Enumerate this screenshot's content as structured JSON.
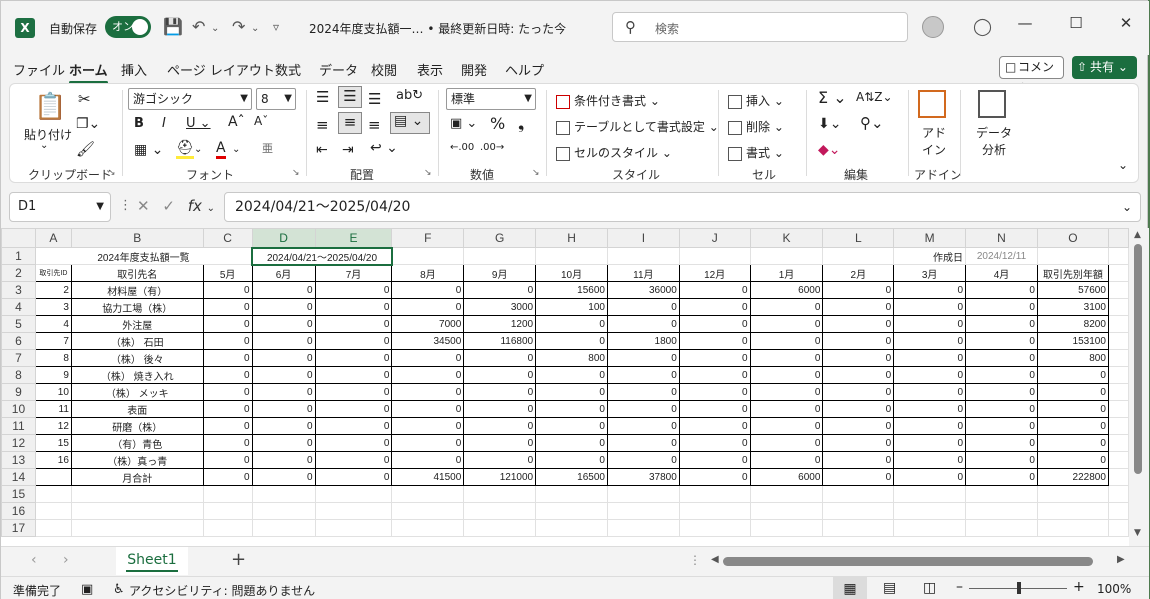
{
  "title_bar": {
    "app_icon": "X",
    "autosave_label": "自動保存",
    "autosave_state": "オン",
    "doc_title": "2024年度支払額一… • 最終更新日時: たった今",
    "search_placeholder": "検索",
    "icons": [
      "save-icon",
      "undo-icon",
      "redo-icon",
      "customize-icon",
      "search-icon",
      "avatar",
      "lightbulb-icon",
      "minimize-icon",
      "maximize-icon",
      "close-icon"
    ]
  },
  "menu": {
    "items": [
      "ファイル",
      "ホーム",
      "挿入",
      "ページ レイアウト",
      "数式",
      "データ",
      "校閲",
      "表示",
      "開発",
      "ヘルプ"
    ],
    "active": "ホーム",
    "comment_label": "コメント",
    "share_label": "共有"
  },
  "ribbon": {
    "clipboard": {
      "paste": "貼り付け",
      "label": "クリップボード"
    },
    "font": {
      "name": "游ゴシック",
      "size": "8",
      "label": "フォント"
    },
    "alignment": {
      "label": "配置"
    },
    "number": {
      "format": "標準",
      "label": "数値"
    },
    "styles": {
      "conditional": "条件付き書式",
      "table": "テーブルとして書式設定",
      "cell": "セルのスタイル",
      "label": "スタイル"
    },
    "cells": {
      "insert": "挿入",
      "delete": "削除",
      "format": "書式",
      "label": "セル"
    },
    "editing": {
      "label": "編集"
    },
    "addins": {
      "button": "アド\nイン",
      "label": "アドイン"
    },
    "analysis": {
      "button": "データ\n分析"
    }
  },
  "formula_bar": {
    "name_box": "D1",
    "formula": "2024/04/21～2025/04/20"
  },
  "sheet": {
    "columns": [
      "A",
      "B",
      "C",
      "D",
      "E",
      "F",
      "G",
      "H",
      "I",
      "J",
      "K",
      "L",
      "M",
      "N",
      "O"
    ],
    "selected_columns": [
      "D",
      "E"
    ],
    "row_numbers": [
      "1",
      "2",
      "3",
      "4",
      "5",
      "6",
      "7",
      "8",
      "9",
      "10",
      "11",
      "12",
      "13",
      "14",
      "15",
      "16",
      "17"
    ],
    "row1": {
      "title": "2024年度支払額一覧",
      "range": "2024/04/21～2025/04/20",
      "created_label": "作成日",
      "created_date": "2024/12/11"
    },
    "header": [
      "取引先ID",
      "取引先名",
      "5月",
      "6月",
      "7月",
      "8月",
      "9月",
      "10月",
      "11月",
      "12月",
      "1月",
      "2月",
      "3月",
      "4月",
      "取引先別年額"
    ],
    "rows": [
      [
        "2",
        "材料屋（有）",
        "0",
        "0",
        "0",
        "0",
        "0",
        "15600",
        "36000",
        "0",
        "6000",
        "0",
        "0",
        "0",
        "57600"
      ],
      [
        "3",
        "協力工場（株）",
        "0",
        "0",
        "0",
        "0",
        "3000",
        "100",
        "0",
        "0",
        "0",
        "0",
        "0",
        "0",
        "3100"
      ],
      [
        "4",
        "外注屋",
        "0",
        "0",
        "0",
        "7000",
        "1200",
        "0",
        "0",
        "0",
        "0",
        "0",
        "0",
        "0",
        "8200"
      ],
      [
        "7",
        "（株） 石田",
        "0",
        "0",
        "0",
        "34500",
        "116800",
        "0",
        "1800",
        "0",
        "0",
        "0",
        "0",
        "0",
        "153100"
      ],
      [
        "8",
        "（株） 後々",
        "0",
        "0",
        "0",
        "0",
        "0",
        "800",
        "0",
        "0",
        "0",
        "0",
        "0",
        "0",
        "800"
      ],
      [
        "9",
        "（株） 焼き入れ",
        "0",
        "0",
        "0",
        "0",
        "0",
        "0",
        "0",
        "0",
        "0",
        "0",
        "0",
        "0",
        "0"
      ],
      [
        "10",
        "（株） メッキ",
        "0",
        "0",
        "0",
        "0",
        "0",
        "0",
        "0",
        "0",
        "0",
        "0",
        "0",
        "0",
        "0"
      ],
      [
        "11",
        "表面",
        "0",
        "0",
        "0",
        "0",
        "0",
        "0",
        "0",
        "0",
        "0",
        "0",
        "0",
        "0",
        "0"
      ],
      [
        "12",
        "研磨（株）",
        "0",
        "0",
        "0",
        "0",
        "0",
        "0",
        "0",
        "0",
        "0",
        "0",
        "0",
        "0",
        "0"
      ],
      [
        "15",
        "（有）青色",
        "0",
        "0",
        "0",
        "0",
        "0",
        "0",
        "0",
        "0",
        "0",
        "0",
        "0",
        "0",
        "0"
      ],
      [
        "16",
        "（株）真っ青",
        "0",
        "0",
        "0",
        "0",
        "0",
        "0",
        "0",
        "0",
        "0",
        "0",
        "0",
        "0",
        "0"
      ]
    ],
    "total_row": [
      "",
      "月合計",
      "0",
      "0",
      "0",
      "41500",
      "121000",
      "16500",
      "37800",
      "0",
      "6000",
      "0",
      "0",
      "0",
      "222800"
    ]
  },
  "tabs": {
    "sheet_name": "Sheet1",
    "add": "+"
  },
  "status": {
    "ready": "準備完了",
    "accessibility": "アクセシビリティ: 問題ありません",
    "zoom": "100%"
  }
}
